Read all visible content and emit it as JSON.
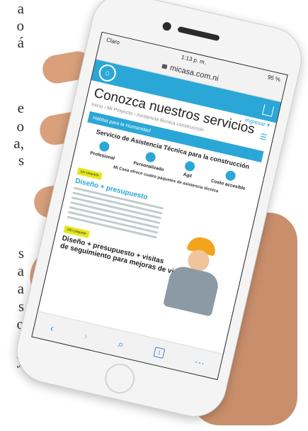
{
  "background_text": [
    "a",
    "o",
    "á",
    "e",
    "o",
    "a,",
    "s",
    "s",
    "a",
    "a",
    "s",
    "o",
    "a",
    "y"
  ],
  "status": {
    "carrier": "Claro",
    "time": "1:13 p. m.",
    "battery": "95 %"
  },
  "url": "micasa.com.ni",
  "site": {
    "title": "Conozca nuestros servicios",
    "login": "Ingresar ▾",
    "breadcrumb": "Inicio  ›  Mi Proyecto  ›  Asistencia técnica construcción",
    "banner": "Hábitat para la Humanidad",
    "service_title": "Servicio de Asistencia Técnica para la construcción",
    "features": [
      "Profesional",
      "Personalizado",
      "Ágil",
      "Costo accesible"
    ],
    "offer": "Mi Casa ofrece cuatro paquetes de asistencia técnica",
    "pkg1_label": "1er paquete",
    "pkg1_title": "Diseño + presupuesto",
    "pkg2_label": "2do paquete",
    "pkg2_title": "Diseño + presupuesto + visitas",
    "pkg2_sub": "de seguimiento para mejoras de vivienda:"
  },
  "toolbar": {
    "back": "‹",
    "forward": "›",
    "search": "⌕",
    "tabs": "1",
    "more": "···"
  }
}
